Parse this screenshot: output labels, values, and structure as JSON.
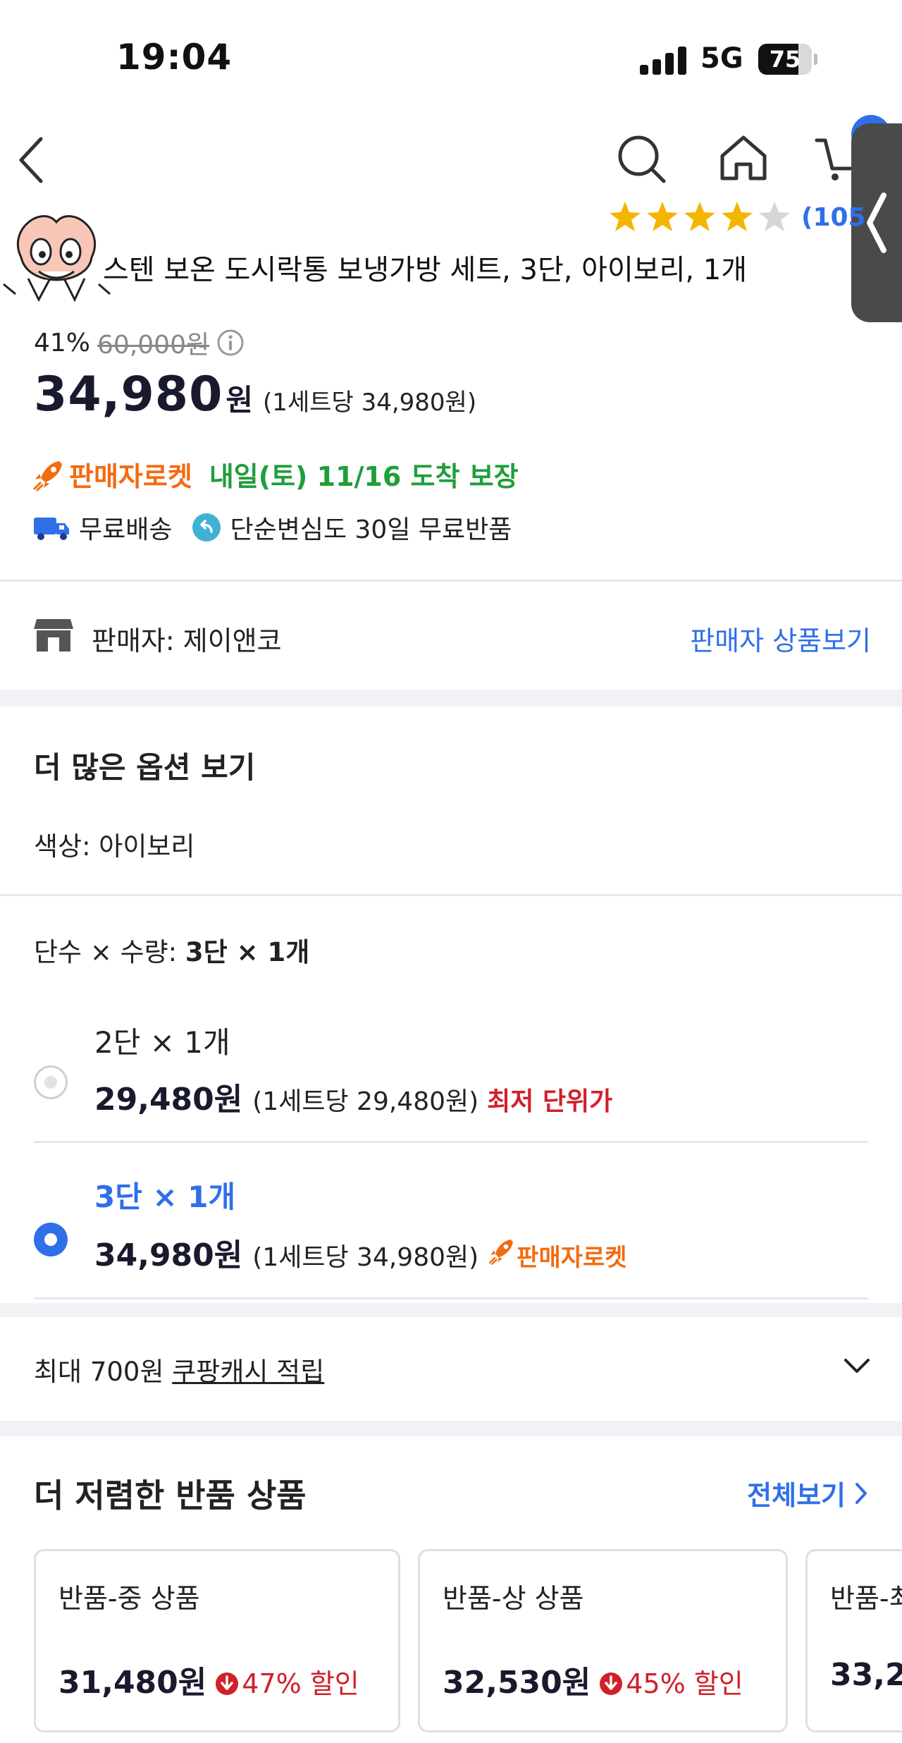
{
  "status_bar": {
    "time": "19:04",
    "network": "5G",
    "battery_level": "75"
  },
  "header": {
    "icons": [
      "back-icon",
      "search-icon",
      "home-icon",
      "cart-icon"
    ],
    "review_count": "(105",
    "rating_stars": 4
  },
  "product": {
    "title": "스텐 보온 도시락통 보냉가방 세트, 3단, 아이보리, 1개",
    "discount_percent": "41%",
    "original_price": "60,000원",
    "price": "34,980",
    "price_suffix": "원",
    "unit_price": "(1세트당 34,980원)",
    "rocket_label": "판매자로켓",
    "delivery_guarantee": "내일(토) 11/16 도착 보장",
    "free_shipping": "무료배송",
    "free_return": "단순변심도 30일 무료반품"
  },
  "seller": {
    "label": "판매자: 제이앤코",
    "link": "판매자 상품보기"
  },
  "options": {
    "heading": "더 많은 옵션 보기",
    "color": "색상: 아이보리",
    "step_qty_prefix": "단수 × 수량: ",
    "step_qty_value": "3단 × 1개",
    "items": [
      {
        "name": "2단 × 1개",
        "price": "29,480원",
        "unit": "(1세트당 29,480원)",
        "badge": "최저 단위가",
        "selected": false
      },
      {
        "name": "3단 × 1개",
        "price": "34,980원",
        "unit": "(1세트당 34,980원)",
        "badge": "판매자로켓",
        "selected": true
      }
    ]
  },
  "cash": {
    "prefix": "최대 700원 ",
    "link": "쿠팡캐시 적립"
  },
  "returns": {
    "heading": "더 저렴한 반품 상품",
    "see_all": "전체보기",
    "cards": [
      {
        "grade": "반품-중 상품",
        "price": "31,480원",
        "discount": "47% 할인"
      },
      {
        "grade": "반품-상 상품",
        "price": "32,530원",
        "discount": "45% 할인"
      },
      {
        "grade": "반품-최",
        "price": "33,2"
      }
    ]
  },
  "colors": {
    "accent_blue": "#2f6fe8",
    "rocket_orange": "#f36b10",
    "delivery_green": "#1f9e3a",
    "discount_red": "#d0202a",
    "star_yellow": "#f5b400"
  }
}
